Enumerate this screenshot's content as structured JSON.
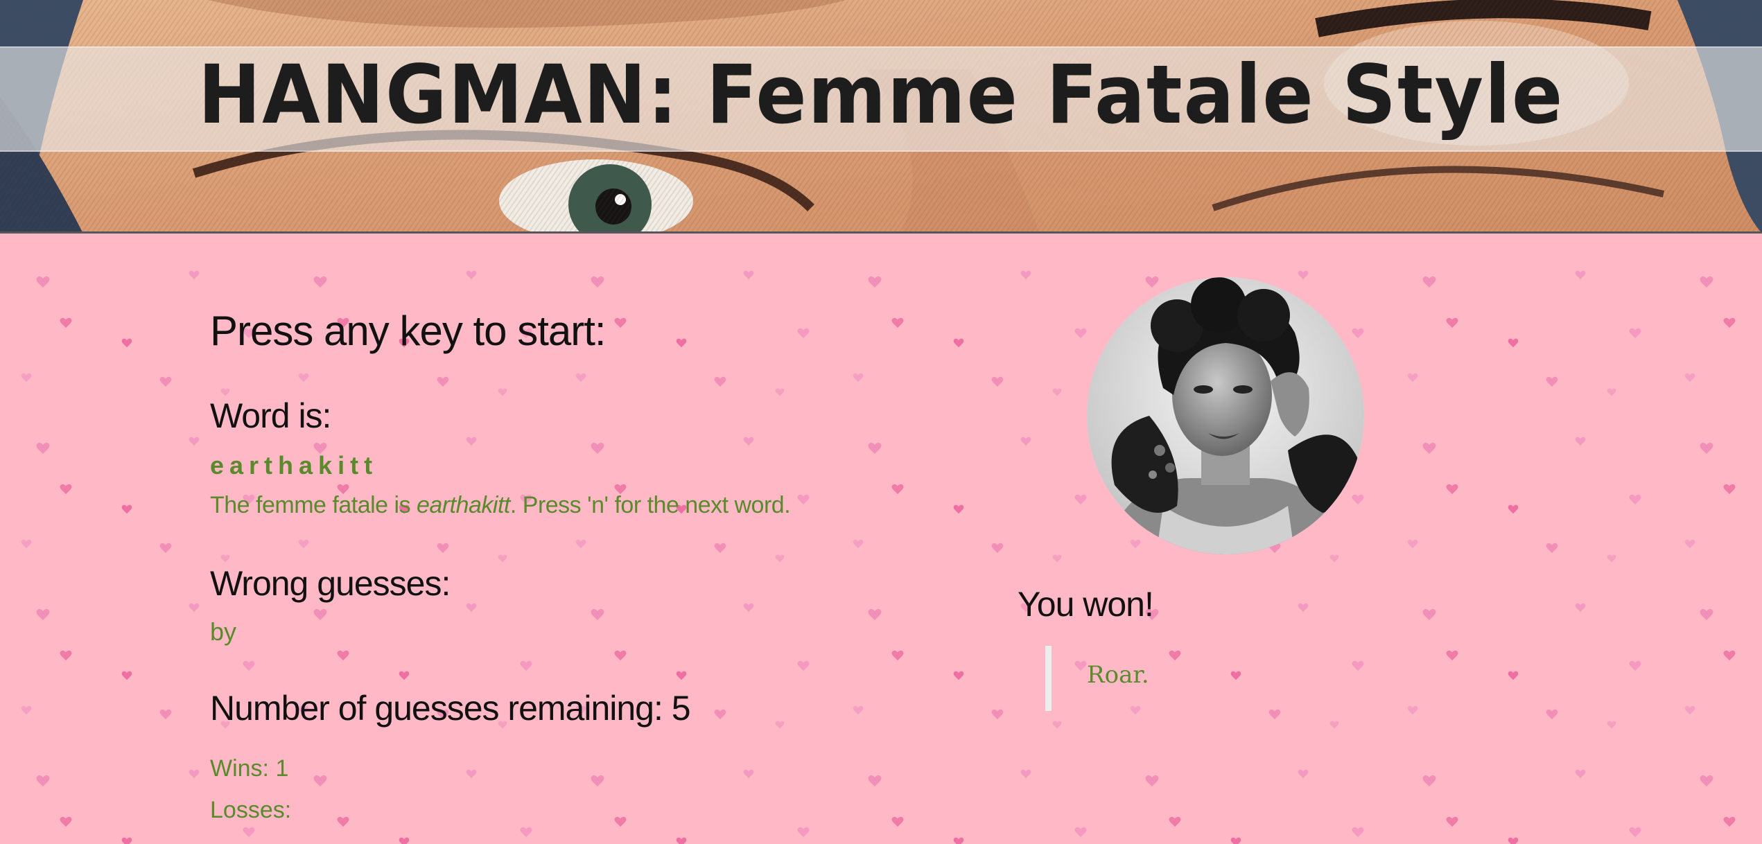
{
  "header": {
    "title": "HANGMAN: Femme Fatale Style"
  },
  "game": {
    "prompt": "Press any key to start:",
    "word_heading": "Word is:",
    "word_display": "earthakitt",
    "reveal_prefix": "The femme fatale is ",
    "reveal_name": "earthakitt",
    "reveal_suffix": ". Press 'n' for the next word.",
    "wrong_heading": "Wrong guesses:",
    "wrong_letters": "by",
    "remaining_label": "Number of guesses remaining: 5",
    "wins_label": "Wins: 1",
    "losses_label": "Losses:"
  },
  "result": {
    "heading": "You won!",
    "quote": "Roar."
  },
  "colors": {
    "background": "#ffb8c6",
    "accent_green": "#5a8a2c",
    "heading_text": "#111111",
    "heart_pink": "#f77fb0"
  }
}
